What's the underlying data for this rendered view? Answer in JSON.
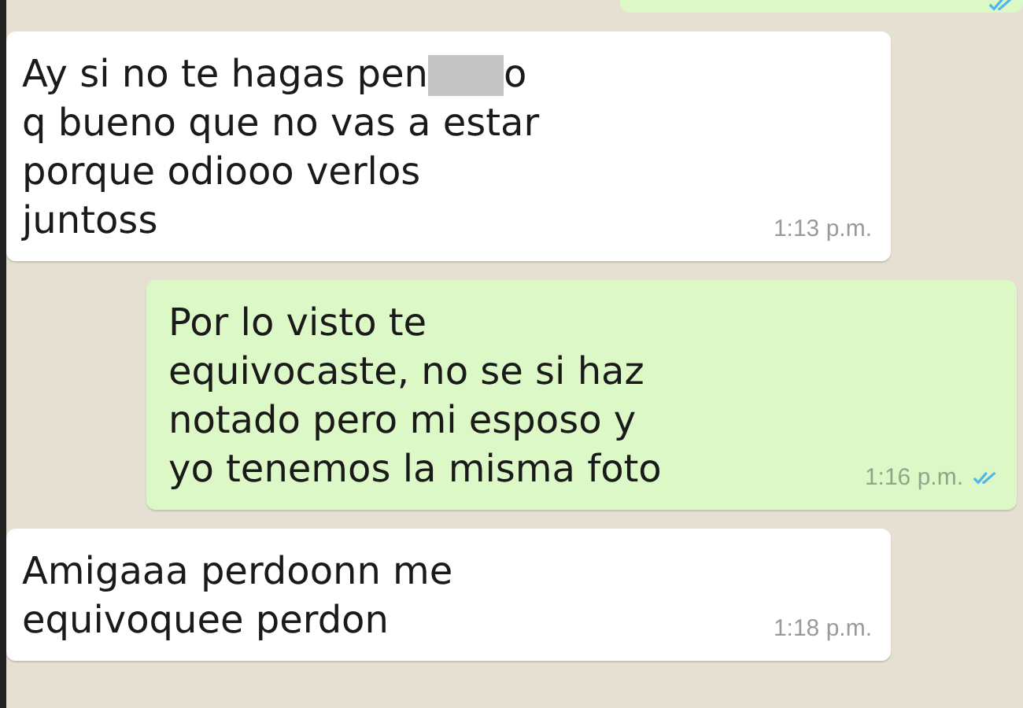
{
  "messages": [
    {
      "kind": "clipped",
      "read": true
    },
    {
      "kind": "incoming",
      "time": "1:13 p.m.",
      "lines": [
        {
          "text": "Ay si no te hagas pen",
          "redacted": true,
          "tail": "o"
        },
        {
          "text": "q bueno que no vas a estar",
          "redacted": false
        },
        {
          "text": "porque odiooo verlos",
          "redacted": false
        },
        {
          "text": "juntoss",
          "redacted": false
        }
      ]
    },
    {
      "kind": "outgoing",
      "time": "1:16 p.m.",
      "read": true,
      "lines": [
        {
          "text": "Por lo visto te",
          "redacted": false
        },
        {
          "text": "equivocaste, no se si haz",
          "redacted": false
        },
        {
          "text": "notado pero mi esposo y",
          "redacted": false
        },
        {
          "text": "yo tenemos la misma foto",
          "redacted": false
        }
      ]
    },
    {
      "kind": "incoming",
      "time": "1:18 p.m.",
      "lines": [
        {
          "text": "Amigaaa perdoonn me",
          "redacted": false
        },
        {
          "text": "equivoquee perdon",
          "redacted": false
        }
      ]
    }
  ]
}
